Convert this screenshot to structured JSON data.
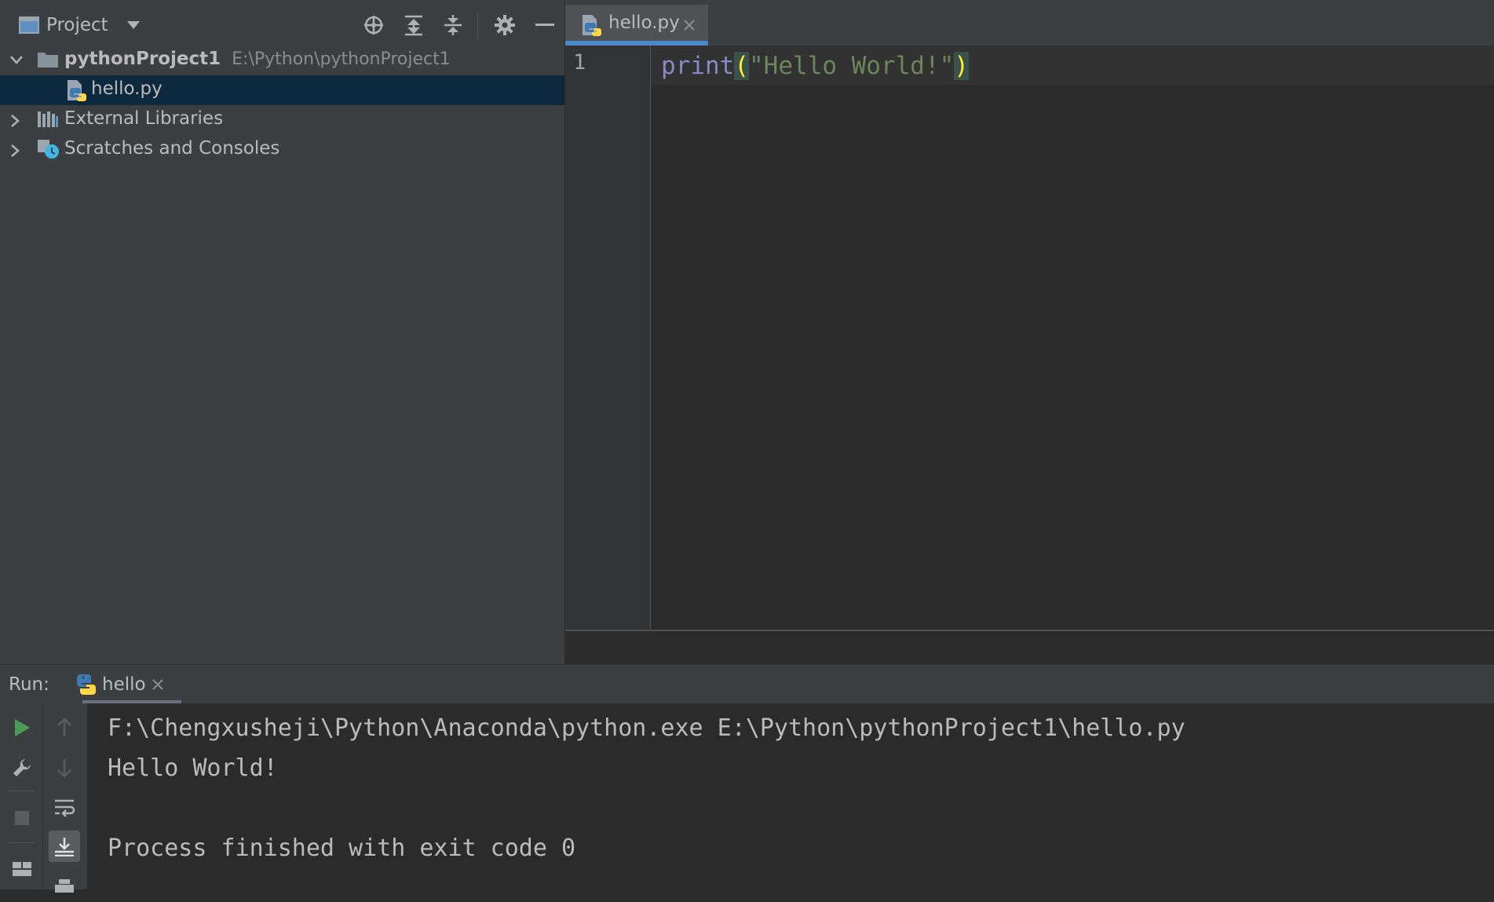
{
  "project_panel": {
    "title": "Project",
    "toolbar_icons": [
      "window-icon",
      "dropdown-icon",
      "locate-icon",
      "expand-all-icon",
      "collapse-all-icon",
      "gear-icon",
      "minimize-icon"
    ],
    "tree": [
      {
        "label": "pythonProject1",
        "path": "E:\\Python\\pythonProject1",
        "expanded": true
      },
      {
        "label": "hello.py",
        "selected": true
      },
      {
        "label": "External Libraries",
        "expanded": false
      },
      {
        "label": "Scratches and Consoles",
        "expanded": false
      }
    ]
  },
  "editor": {
    "tab_label": "hello.py",
    "line_number": "1",
    "code": {
      "builtin": "print",
      "open": "(",
      "string": "\"Hello World!\"",
      "close": ")"
    }
  },
  "run_panel": {
    "label": "Run:",
    "tab_label": "hello",
    "output": [
      "F:\\Chengxusheji\\Python\\Anaconda\\python.exe E:\\Python\\pythonProject1\\hello.py",
      "Hello World!",
      "",
      "Process finished with exit code 0"
    ]
  },
  "colors": {
    "accent": "#4a88c7",
    "run_green": "#499c54",
    "selection": "#0d293e",
    "python_blue": "#3d7ab3",
    "python_yellow": "#ffd845"
  }
}
